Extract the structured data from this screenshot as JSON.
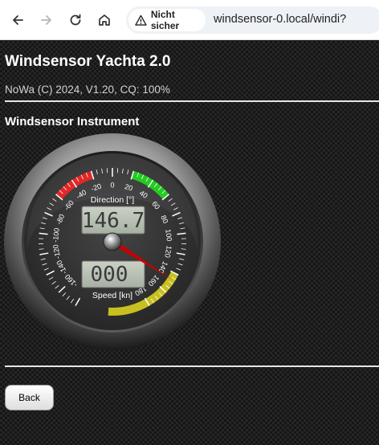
{
  "browser": {
    "security_label": "Nicht sicher",
    "url": "windsensor-0.local/windi?"
  },
  "header": {
    "title": "Windsensor Yachta 2.0",
    "version_line": "NoWa (C) 2024, V1.20, CQ: 100%"
  },
  "instrument": {
    "title": "Windsensor Instrument",
    "direction_label": "Direction [°]",
    "direction_value": "146.7",
    "speed_label": "Speed [kn]",
    "speed_value": "000",
    "scale_min": -180,
    "scale_max": 180,
    "tick_labels": [
      "-160",
      "-140",
      "-120",
      "-100",
      "-80",
      "-60",
      "-40",
      "-20",
      "0",
      "20",
      "40",
      "60",
      "80",
      "100",
      "120",
      "140",
      "160",
      "180"
    ],
    "pointer_direction": 146.7,
    "zones": [
      {
        "name": "port",
        "from": -60,
        "to": -20,
        "color": "#e02828"
      },
      {
        "name": "starboard",
        "from": 20,
        "to": 60,
        "color": "#22cc22"
      },
      {
        "name": "downwind",
        "from": 140,
        "to": 220,
        "color": "#c8c020"
      }
    ],
    "colors": {
      "pointer": "#c80000",
      "lcd_bg": "#b8c2b4",
      "lcd_text": "#3a3a3a"
    }
  },
  "footer": {
    "back_label": "Back"
  }
}
